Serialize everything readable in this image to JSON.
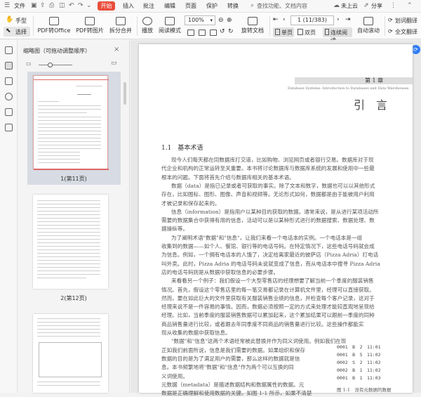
{
  "titlebar": {
    "file": "文件",
    "menus": [
      "开始",
      "插入",
      "批注",
      "编辑",
      "页面",
      "保护",
      "转换"
    ],
    "search": "查找功能、文档内容",
    "cloud": "未上云",
    "share": "分享"
  },
  "toolbar": {
    "hand": "手型",
    "select": "选择",
    "pdf_office": "PDF转Office",
    "pdf_image": "PDF转图片",
    "split_merge": "拆分合并",
    "play": "播放",
    "read_mode": "阅读模式",
    "zoom": "100%",
    "rotate": "旋转文档",
    "single_page": "单页",
    "double_page": "双页",
    "continuous": "连续阅读",
    "auto_scroll": "自动滚动",
    "page_indicator": "1 (11/383)",
    "translate_word": "划词翻译",
    "translate_full": "全文翻译"
  },
  "thumbnail_panel": {
    "title": "缩略图（可拖动调整顺序）",
    "thumbs": [
      {
        "label": "1(第11页)"
      },
      {
        "label": "2(第12页)"
      }
    ]
  },
  "document": {
    "chapter_label": "第 1 章",
    "chapter_subtitle": "Database Systems: Introduction to Databases and Data Warehouses",
    "chapter_title": "引　言",
    "section_heading": "1.1　基本术语",
    "paragraphs": [
      "现今人们每天都在同数据库打交道，比如购物、浏览网页或者银行交易。数据库对于现",
      "代企业和机构的正常运转至关重要。本书将讨论数据库与数据库系统的发展和使用中一些最",
      "根本的问题。下面将首先介绍与数据库相关的基本术语。",
      "数据（data）是指已记录或者可获取的事实。除了文本和数字，数据也可以以其他形式",
      "存在，比如图标、图形、图像、声音和视频等。无论形式如何，数据都是由于能被用户利用",
      "才被记录和保存起来的。",
      "信息（information）是指用户以某种目的获取的数据。通常来说，是从进行某项活动所",
      "需要的数据集合中获得有用的信息，活动可以是以某种形式进行的数据搜索、数据处理、数",
      "据操纵等。",
      "为了阐明术语\"数据\"和\"信息\"，让我们来看一个电话本的实例。一个电话本是一组",
      "收集到的数据——如个人、餐馆、银行等的电话号码。在特定情况下，这些电话号码就会成",
      "为信息。例如，一个拥有电话本的人饿了，决定给离家最近的披萨店（Pizza Adria）打电话",
      "叫外卖。此时，Pizza Adria 的电话号码未说就变成了信息，而从电话本中搜寻 Pizza Adria",
      "店的电话号码则是从数据中获取信息的必要步骤。",
      "来看看另一个例子：我们假设一个大型零售店的经理想要了解当前一个季度的服装销售",
      "情况。首先，假设这个零售店里的每一笔交易都记录在计算机文件里，经理可以直接获取。",
      "然而，要在如此巨大的文件里获取有关服装销售业绩的信息，并检查每个客户记录，这对于",
      "经理来说不是一件容易的事情。因而，数据必须按照一定的方式来处理才能较直观地呈现给",
      "经理。比如，当前季度的服装销售数据可以累加起来，这个累加结果可以跟前一季度的同种",
      "商品销售量进行比较，或者跟去年同季度不同商品的销售量进行比较。这些操作都能实",
      "现从收集的数据中获取信息。",
      "\"数据\"和\"信息\"这两个术语经常被此替换并作为同义词使用。例如我们在现",
      "正如我们前面所说，信息是我们需要的数据。如果组织和保存",
      "数据的目的是为了满足用户的需要，那么这样的数据就是信",
      "息。本书频繁地将\"数据\"和\"信息\"作为两个可以互换的同",
      "义词使用。",
      "元数据（metadata）是描述数据结构和数据属性的数据。元",
      "数据是正确理解和使用数据的关键。如图 1-1 所示，如果不清楚"
    ],
    "table_rows": [
      "0001　B　2　11:01",
      "0001　B　5　11:02",
      "0002　S　2　11:02",
      "0002　B　1　11:02",
      "0001　B　1　11:03"
    ],
    "figure_caption": "图 1-1　没有元数据的数据"
  }
}
